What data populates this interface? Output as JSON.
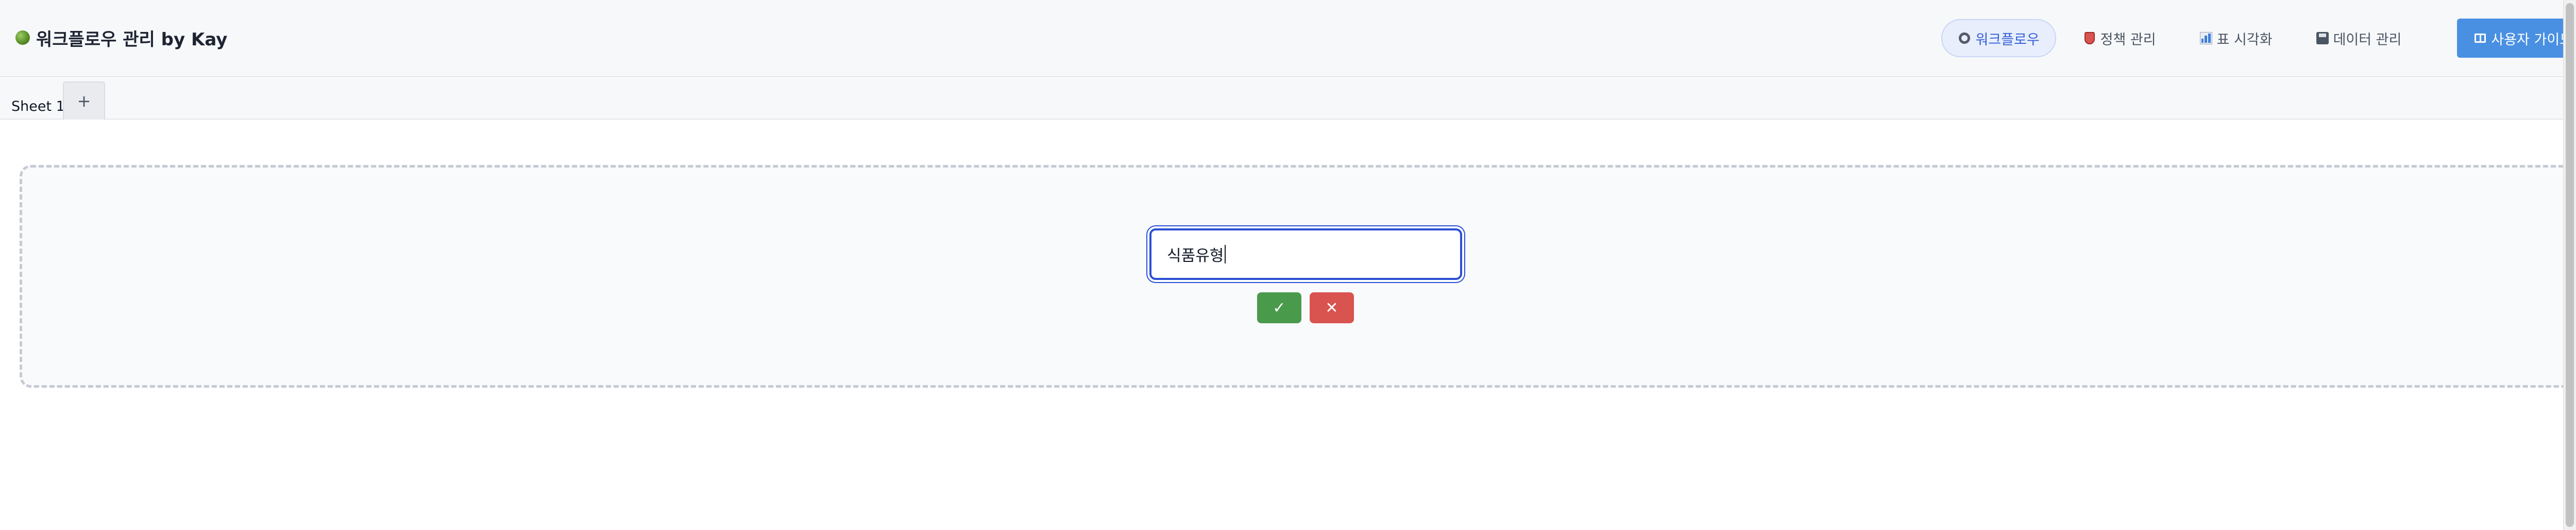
{
  "header": {
    "title": "워크플로우 관리 by Kay",
    "nav": [
      {
        "label": "워크플로우",
        "icon": "ring-icon",
        "active": true
      },
      {
        "label": "정책 관리",
        "icon": "shield-icon",
        "active": false
      },
      {
        "label": "표 시각화",
        "icon": "bar-chart-icon",
        "active": false
      },
      {
        "label": "데이터 관리",
        "icon": "floppy-disk-icon",
        "active": false
      }
    ],
    "guide_button": {
      "label": "사용자 가이드",
      "icon": "book-icon"
    }
  },
  "tabs": {
    "sheets": [
      "Sheet 1"
    ],
    "add_label": "+"
  },
  "editor": {
    "input_value": "식품유형",
    "confirm_label": "✓",
    "cancel_label": "✕"
  },
  "colors": {
    "accent": "#4a90e2",
    "active_nav_text": "#3560d6",
    "confirm": "#4a9a4c",
    "cancel": "#d9534f"
  }
}
